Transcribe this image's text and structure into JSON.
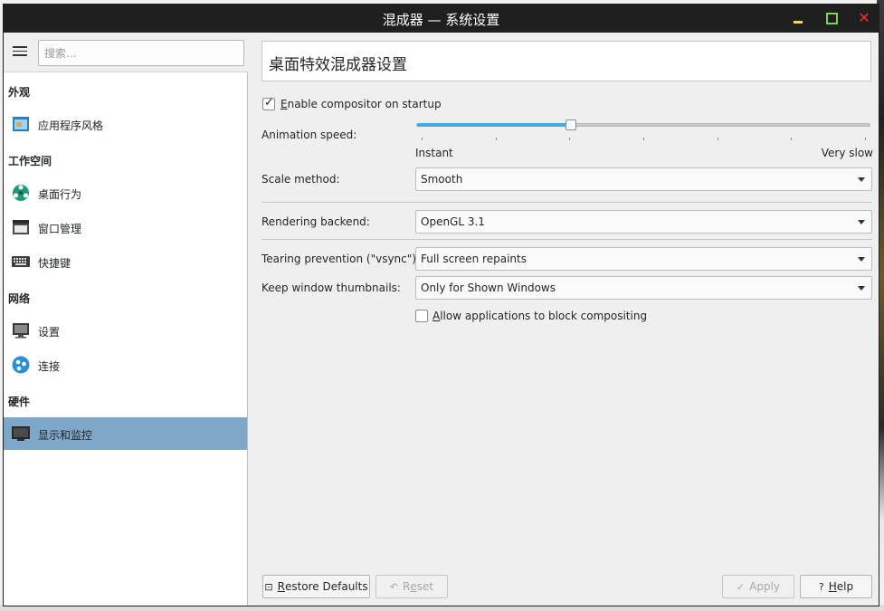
{
  "window": {
    "title": "混成器 — 系统设置"
  },
  "sidebar": {
    "search_placeholder": "搜索...",
    "categories": [
      {
        "label": "外观"
      },
      {
        "label": "工作空间"
      },
      {
        "label": "网络"
      },
      {
        "label": "硬件"
      }
    ],
    "items": [
      {
        "label": "应用程序风格",
        "icon": "app-style-icon"
      },
      {
        "label": "桌面行为",
        "icon": "desktop-behavior-icon"
      },
      {
        "label": "窗口管理",
        "icon": "window-management-icon"
      },
      {
        "label": "快捷键",
        "icon": "keyboard-icon"
      },
      {
        "label": "设置",
        "icon": "network-settings-icon"
      },
      {
        "label": "连接",
        "icon": "connections-icon"
      },
      {
        "label": "显示和监控",
        "icon": "monitor-icon",
        "selected": true
      }
    ]
  },
  "content": {
    "header": "桌面特效混成器设置",
    "enable_compositor": {
      "label_first": "E",
      "label_rest": "nable compositor on startup",
      "checked": true
    },
    "animation_speed": {
      "label": "Animation speed:",
      "value_fraction": 0.34,
      "min_label": "Instant",
      "max_label": "Very slow"
    },
    "scale_method": {
      "label": "Scale method:",
      "value": "Smooth"
    },
    "rendering_backend": {
      "label": "Rendering backend:",
      "value": "OpenGL 3.1"
    },
    "tearing_prevention": {
      "label": "Tearing prevention (\"vsync\"):",
      "value": "Full screen repaints"
    },
    "keep_thumbnails": {
      "label": "Keep window thumbnails:",
      "value": "Only for Shown Windows"
    },
    "allow_block": {
      "label_first": "A",
      "label_rest": "llow applications to block compositing",
      "checked": false
    }
  },
  "buttons": {
    "restore_defaults": {
      "first": "R",
      "rest": "estore Defaults"
    },
    "reset": {
      "pre": "R",
      "ul": "e",
      "rest": "set"
    },
    "apply": {
      "label": "Apply"
    },
    "help": {
      "first": "H",
      "rest": "elp"
    }
  },
  "colors": {
    "accent": "#3daee9",
    "selection": "#7ea8c9",
    "titlebar": "#1f1f1f"
  }
}
